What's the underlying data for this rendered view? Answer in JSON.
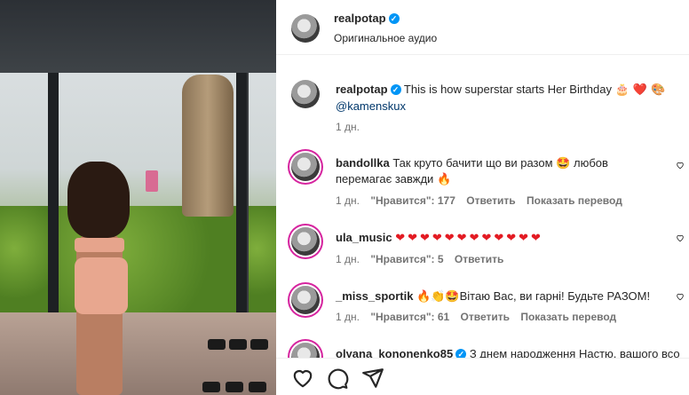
{
  "post": {
    "author": "realpotap",
    "audio": "Оригинальное аудио",
    "caption": {
      "username": "realpotap",
      "text": "This is how superstar starts Her Birthday",
      "emoji": "🎂 ❤️ 🎨",
      "mention": "@kamenskux",
      "time": "1 дн."
    }
  },
  "comments": [
    {
      "username": "bandollka",
      "text_line1": "Так круто бачити що ви разом",
      "emoji1": "🤩",
      "text_line1b": "любов",
      "text_line2": "перемагає завжди",
      "emoji2": "🔥",
      "time": "1 дн.",
      "likes": "\"Нравится\": 177",
      "reply": "Ответить",
      "translate": "Показать перевод"
    },
    {
      "username": "ula_music",
      "hearts": "❤❤❤❤❤❤❤❤❤❤❤❤",
      "time": "1 дн.",
      "likes": "\"Нравится\": 5",
      "reply": "Ответить"
    },
    {
      "username": "_miss_sportik",
      "emoji": "🔥👏🤩",
      "text": "Вітаю Вас, ви гарні! Будьте РАЗОМ!",
      "time": "1 дн.",
      "likes": "\"Нравится\": 61",
      "reply": "Ответить",
      "translate": "Показать перевод"
    },
    {
      "username": "olyana_kononenko85",
      "text": "З днем народження Настю, вашого всо"
    }
  ],
  "icons": [
    "heart-icon",
    "comment-icon",
    "share-icon",
    "verified-icon"
  ],
  "colors": {
    "verified": "#0095f6",
    "mention": "#00376b",
    "meta": "#737373",
    "story_ring": "#d6249f"
  }
}
